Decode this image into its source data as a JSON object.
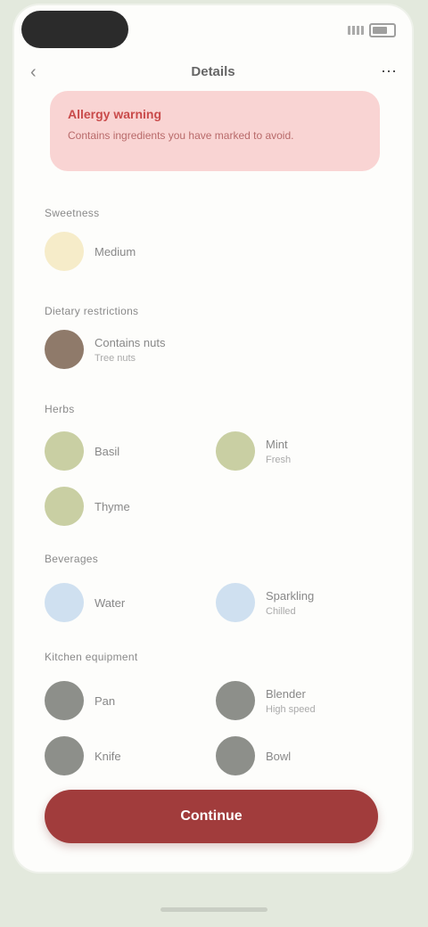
{
  "app": {
    "title": "Details"
  },
  "alert": {
    "title": "Allergy warning",
    "message": "Contains ingredients you have marked to avoid."
  },
  "sections": [
    {
      "label": "Sweetness",
      "items": [
        {
          "name": "Medium",
          "sub": "",
          "color": "#f6ecc9",
          "icon": "honey-icon"
        }
      ]
    },
    {
      "label": "Dietary restrictions",
      "items": [
        {
          "name": "Contains nuts",
          "sub": "Tree nuts",
          "color": "#8f7a6a",
          "icon": "nut-icon"
        }
      ]
    },
    {
      "label": "Herbs",
      "items": [
        {
          "name": "Basil",
          "sub": "",
          "color": "#c9cfa3",
          "icon": "basil-icon"
        },
        {
          "name": "Mint",
          "sub": "Fresh",
          "color": "#c9cfa3",
          "icon": "mint-icon"
        },
        {
          "name": "Thyme",
          "sub": "",
          "color": "#c9cfa3",
          "icon": "thyme-icon"
        }
      ]
    },
    {
      "label": "Beverages",
      "items": [
        {
          "name": "Water",
          "sub": "",
          "color": "#cfe0f0",
          "icon": "water-icon"
        },
        {
          "name": "Sparkling",
          "sub": "Chilled",
          "color": "#cfe0f0",
          "icon": "sparkling-icon"
        }
      ]
    },
    {
      "label": "Kitchen equipment",
      "items": [
        {
          "name": "Pan",
          "sub": "",
          "color": "#8d8f8a",
          "icon": "pan-icon"
        },
        {
          "name": "Blender",
          "sub": "High speed",
          "color": "#8d8f8a",
          "icon": "blender-icon"
        },
        {
          "name": "Knife",
          "sub": "",
          "color": "#8d8f8a",
          "icon": "knife-icon"
        },
        {
          "name": "Bowl",
          "sub": "",
          "color": "#8d8f8a",
          "icon": "bowl-icon"
        }
      ]
    }
  ],
  "button": {
    "label": "Continue"
  },
  "colors": {
    "accent": "#a13c3c",
    "alert_bg": "#f9d4d3"
  }
}
